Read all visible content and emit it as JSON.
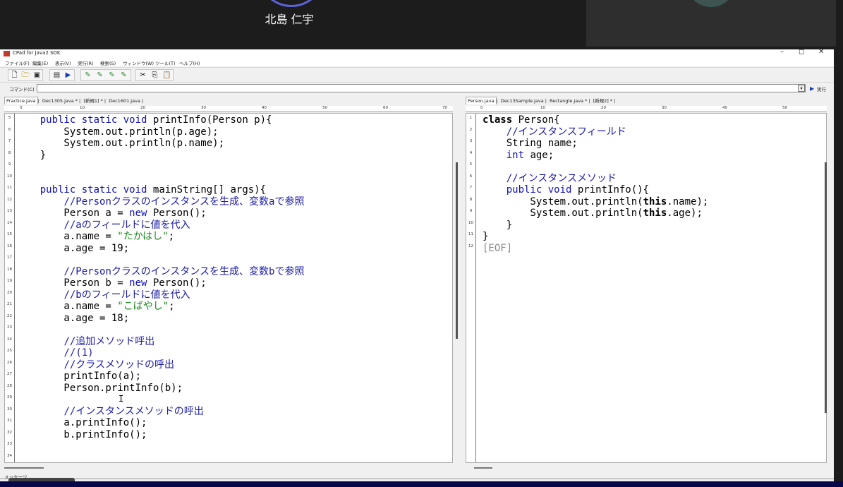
{
  "meeting": {
    "participant_name": "北島 仁宇"
  },
  "window": {
    "title": "CPad for Java2 SDK",
    "controls": {
      "minimize": "–",
      "maximize": "◻",
      "close": "✕"
    }
  },
  "menu": [
    "ファイル(F)",
    "編集(E)",
    "表示(V)",
    "実行(R)",
    "検索(S)",
    "ウィンドウ(W)",
    "ツール(T)",
    "ヘルプ(H)"
  ],
  "command_bar": {
    "label": "コマンド(C)",
    "value": "",
    "dropdown": "▾",
    "run_label": "実行"
  },
  "left_pane": {
    "tabs": [
      "Practice.java",
      "Dec1305.java *",
      "[新規1] *",
      "Dec1601.java"
    ],
    "ruler": [
      "0",
      "10",
      "20",
      "30",
      "40",
      "50",
      "60",
      "70"
    ],
    "line_numbers": [
      "5",
      "6",
      "7",
      "8",
      "9",
      "10",
      "11",
      "12",
      "13",
      "14",
      "15",
      "16",
      "17",
      "18",
      "19",
      "20",
      "21",
      "22",
      "23",
      "24",
      "25",
      "26",
      "27",
      "28",
      "29",
      "30",
      "31",
      "32",
      "33",
      "34"
    ],
    "code_lines": [
      "    public static void printInfo(Person p){",
      "        System.out.println(p.age);",
      "        System.out.println(p.name);",
      "    }",
      "",
      "",
      "    public static void mainString[] args){",
      "        //Personクラスのインスタンスを生成、変数aで参照",
      "        Person a = new Person();",
      "        //aのフィールドに値を代入",
      "        a.name = \"たかはし\";",
      "        a.age = 19;",
      "",
      "        //Personクラスのインスタンスを生成、変数bで参照",
      "        Person b = new Person();",
      "        //bのフィールドに値を代入",
      "        a.name = \"こばやし\";",
      "        a.age = 18;",
      "",
      "        //追加メソッド呼出",
      "        //(1)",
      "        //クラスメソッドの呼出",
      "        printInfo(a);",
      "        Person.printInfo(b);",
      "",
      "        //インスタンスメソッドの呼出",
      "        a.printInfo();",
      "        b.printInfo();",
      "",
      ""
    ]
  },
  "right_pane": {
    "tabs": [
      "Person.java",
      "Dec13Sample.java",
      "Rectangle.java *",
      "[新規2] *"
    ],
    "ruler": [
      "0",
      "10",
      "20",
      "30",
      "40",
      "50"
    ],
    "line_numbers": [
      "1",
      "2",
      "3",
      "4",
      "5",
      "6",
      "7",
      "8",
      "9",
      "10",
      "11",
      "12"
    ],
    "code_lines": [
      "class Person{",
      "    //インスタンスフィールド",
      "    String name;",
      "    int age;",
      "",
      "    //インスタンスメソッド",
      "    public void printInfo(){",
      "        System.out.println(this.name);",
      "        System.out.println(this.age);",
      "    }",
      "}",
      "[EOF]"
    ]
  },
  "message_label": "メッセージ"
}
